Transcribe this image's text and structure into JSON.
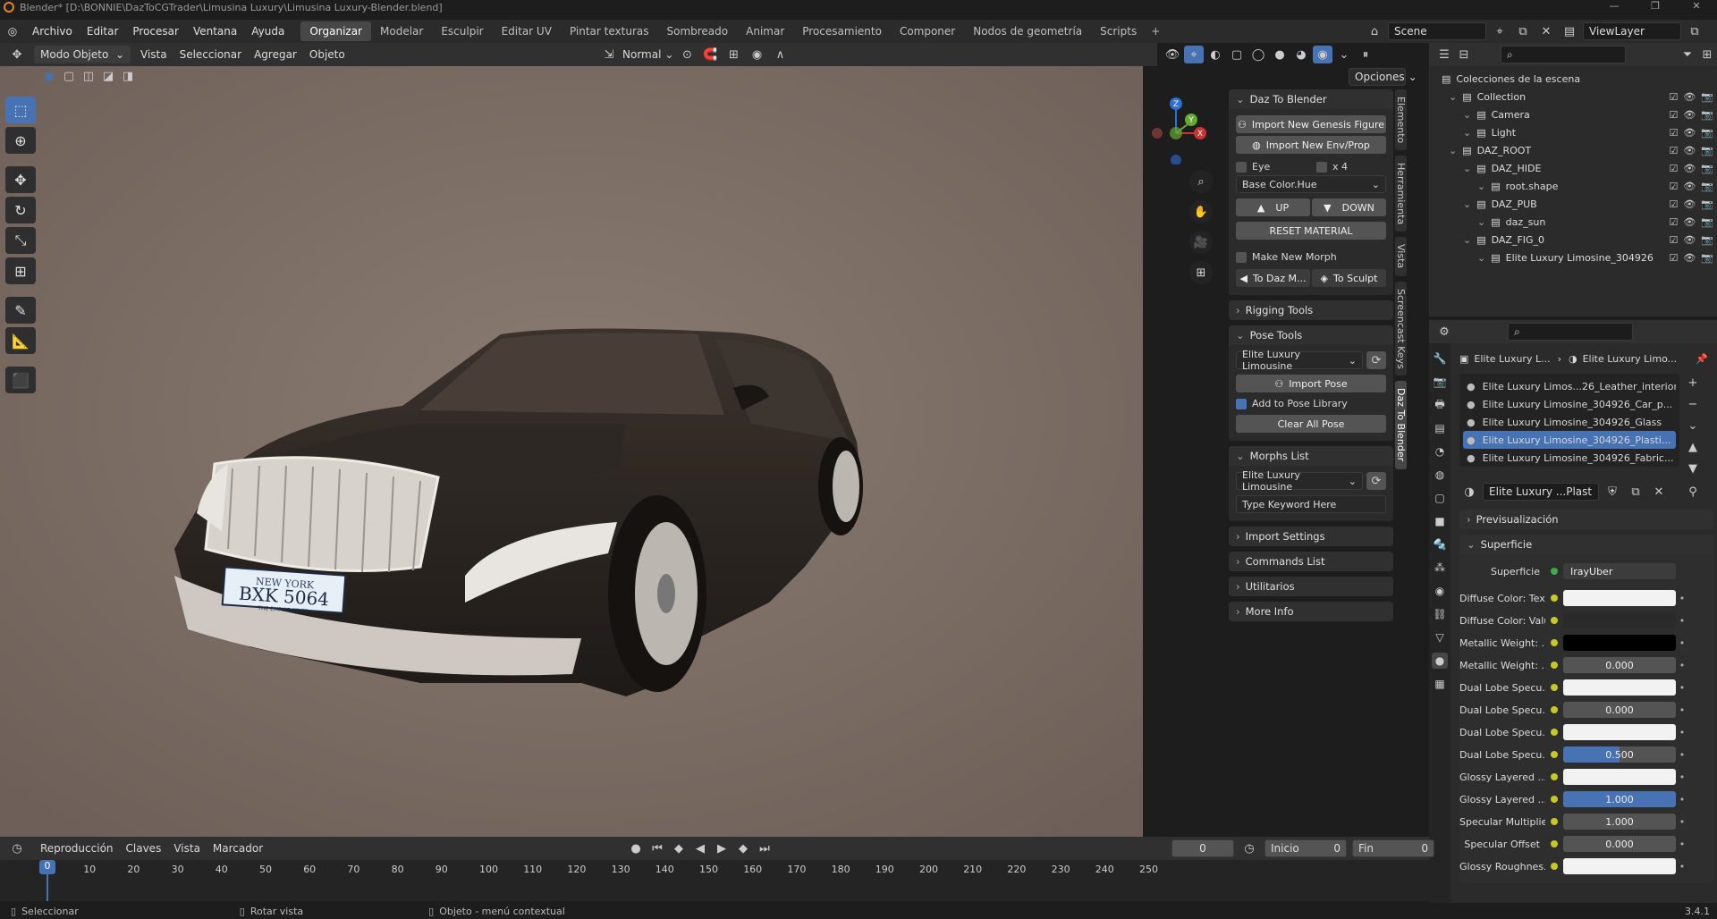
{
  "title": "Blender* [D:\\BONNIE\\DazToCGTrader\\Limusina Luxury\\Limusina Luxury-Blender.blend]",
  "menu": [
    "Archivo",
    "Editar",
    "Procesar",
    "Ventana",
    "Ayuda"
  ],
  "workspaces": [
    "Organizar",
    "Modelar",
    "Esculpir",
    "Editar UV",
    "Pintar texturas",
    "Sombreado",
    "Animar",
    "Procesamiento",
    "Componer",
    "Nodos de geometría",
    "Scripts"
  ],
  "active_workspace": "Organizar",
  "scene": "Scene",
  "view_layer": "ViewLayer",
  "viewport": {
    "mode": "Modo Objeto",
    "menu": [
      "Vista",
      "Seleccionar",
      "Agregar",
      "Objeto"
    ],
    "orientation": "Normal",
    "options": "Opciones",
    "bg_color": "#7b6c63"
  },
  "gizmo": {
    "z": "Z",
    "y": "Y",
    "x": "X"
  },
  "npanel": {
    "daz_header": "Daz To Blender",
    "import_figure": "Import New Genesis Figure",
    "import_env": "Import New Env/Prop",
    "eye": "Eye",
    "x4": "x 4",
    "base_color": "Base Color.Hue",
    "up": "UP",
    "down": "DOWN",
    "reset_material": "RESET MATERIAL",
    "make_new_morph": "Make New Morph",
    "to_daz": "To Daz M...",
    "to_sculpt": "To Sculpt",
    "rigging_tools": "Rigging Tools",
    "pose_tools": "Pose Tools",
    "pose_figure": "Elite Luxury Limousine",
    "import_pose": "Import Pose",
    "add_pose_library": "Add to Pose Library",
    "clear_all_pose": "Clear All Pose",
    "morphs_list": "Morphs List",
    "morph_figure": "Elite Luxury Limousine",
    "keyword_placeholder": "Type Keyword Here",
    "import_settings": "Import Settings",
    "commands_list": "Commands List",
    "utilitarios": "Utilitarios",
    "more_info": "More Info"
  },
  "vtabs": [
    "Elemento",
    "Herramienta",
    "Vista",
    "Screencast Keys",
    "Daz To Blender"
  ],
  "outliner": {
    "root": "Colecciones de la escena",
    "items": [
      {
        "label": "Collection",
        "indent": 0
      },
      {
        "label": "Camera",
        "indent": 1
      },
      {
        "label": "Light",
        "indent": 1
      },
      {
        "label": "DAZ_ROOT",
        "indent": 0
      },
      {
        "label": "DAZ_HIDE",
        "indent": 1
      },
      {
        "label": "root.shape",
        "indent": 2
      },
      {
        "label": "DAZ_PUB",
        "indent": 1
      },
      {
        "label": "daz_sun",
        "indent": 2
      },
      {
        "label": "DAZ_FIG_0",
        "indent": 1
      },
      {
        "label": "Elite Luxury Limosine_304926",
        "indent": 2
      }
    ]
  },
  "props": {
    "breadcrumb_obj": "Elite Luxury L...",
    "breadcrumb_mat": "Elite Luxury Limo...",
    "materials": [
      "Elite Luxury Limos...26_Leather_interior",
      "Elite Luxury Limosine_304926_Car_p...",
      "Elite Luxury Limosine_304926_Glass",
      "Elite Luxury Limosine_304926_Plasti...",
      "Elite Luxury Limosine_304926_Fabric..."
    ],
    "active_material": "Elite Luxury ...Plastic_Black",
    "preview": "Previsualización",
    "surface_section": "Superficie",
    "surface_label": "Superficie",
    "surface_value": "IrayUber",
    "rows": [
      {
        "label": "Diffuse Color: Tex...",
        "value": "",
        "kind": "white"
      },
      {
        "label": "Diffuse Color: Value",
        "value": "",
        "kind": "dark"
      },
      {
        "label": "Metallic Weight: ...",
        "value": "",
        "kind": "black"
      },
      {
        "label": "Metallic Weight: ...",
        "value": "0.000",
        "kind": "num"
      },
      {
        "label": "Dual Lobe Specu...",
        "value": "",
        "kind": "white"
      },
      {
        "label": "Dual Lobe Specu...",
        "value": "0.000",
        "kind": "num"
      },
      {
        "label": "Dual Lobe Specu...",
        "value": "",
        "kind": "white"
      },
      {
        "label": "Dual Lobe Specu...",
        "value": "0.500",
        "kind": "half"
      },
      {
        "label": "Glossy Layered ...",
        "value": "",
        "kind": "white"
      },
      {
        "label": "Glossy Layered ...",
        "value": "1.000",
        "kind": "full"
      },
      {
        "label": "Specular Multiplier",
        "value": "1.000",
        "kind": "num"
      },
      {
        "label": "Specular Offset",
        "value": "0.000",
        "kind": "num"
      },
      {
        "label": "Glossy Roughnes...",
        "value": "",
        "kind": "white"
      }
    ]
  },
  "timeline": {
    "menu": [
      "Reproducción",
      "Claves",
      "Vista",
      "Marcador"
    ],
    "current_frame": "0",
    "start_label": "Inicio",
    "start": "0",
    "end_label": "Fin",
    "end": "0",
    "ticks": [
      "0",
      "10",
      "20",
      "30",
      "40",
      "50",
      "60",
      "70",
      "80",
      "90",
      "100",
      "110",
      "120",
      "130",
      "140",
      "150",
      "160",
      "170",
      "180",
      "190",
      "200",
      "210",
      "220",
      "230",
      "240",
      "250"
    ]
  },
  "status": {
    "select": "Seleccionar",
    "rotate": "Rotar vista",
    "context": "Objeto - menú contextual",
    "version": "3.4.1"
  },
  "plate": {
    "top": "NEW YORK",
    "number": "BXK 5064",
    "bottom": "THE EMPIRE STATE"
  }
}
